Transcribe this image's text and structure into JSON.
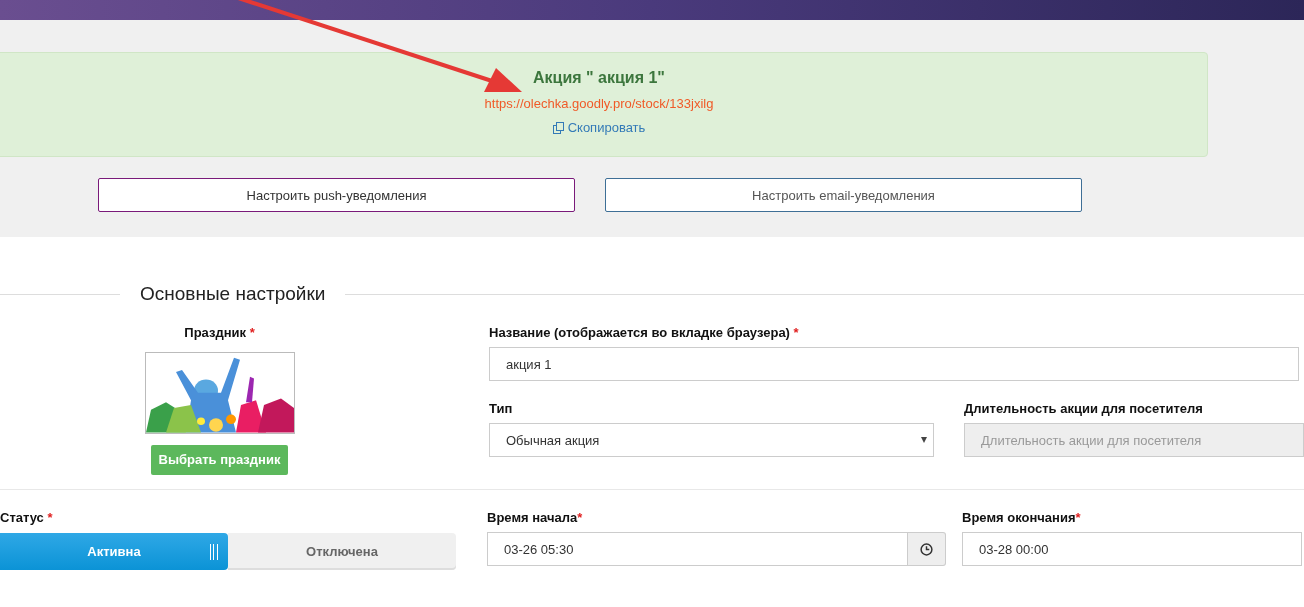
{
  "alert": {
    "title": "Акция \" акция 1\"",
    "link": "https://olechka.goodly.pro/stock/133jxilg",
    "copy": "Скопировать"
  },
  "notify_buttons": [
    {
      "label": "Настроить push-уведомления",
      "kind": "push"
    },
    {
      "label": "Настроить email-уведомления",
      "kind": "email"
    }
  ],
  "section": {
    "title": "Основные настройки"
  },
  "holiday": {
    "label": "Праздник",
    "mark": "*",
    "button": "Выбрать праздник"
  },
  "name_field": {
    "label": "Название (отображается во вкладке браузера)",
    "mark": "*",
    "value": "акция 1"
  },
  "type_field": {
    "label": "Тип",
    "value": "Обычная акция"
  },
  "duration_field": {
    "label": "Длительность акции для посетителя",
    "placeholder": "Длительность акции для посетителя",
    "disabled": true
  },
  "status": {
    "label": "Статус",
    "mark": "*",
    "options": [
      {
        "label": "Активна",
        "selected": true
      },
      {
        "label": "Отключена",
        "selected": false
      }
    ]
  },
  "start_time": {
    "label": "Время начала",
    "mark": "*",
    "value": "03-26 05:30"
  },
  "end_time": {
    "label": "Время окончания",
    "mark": "*",
    "value": "03-28 00:00"
  }
}
